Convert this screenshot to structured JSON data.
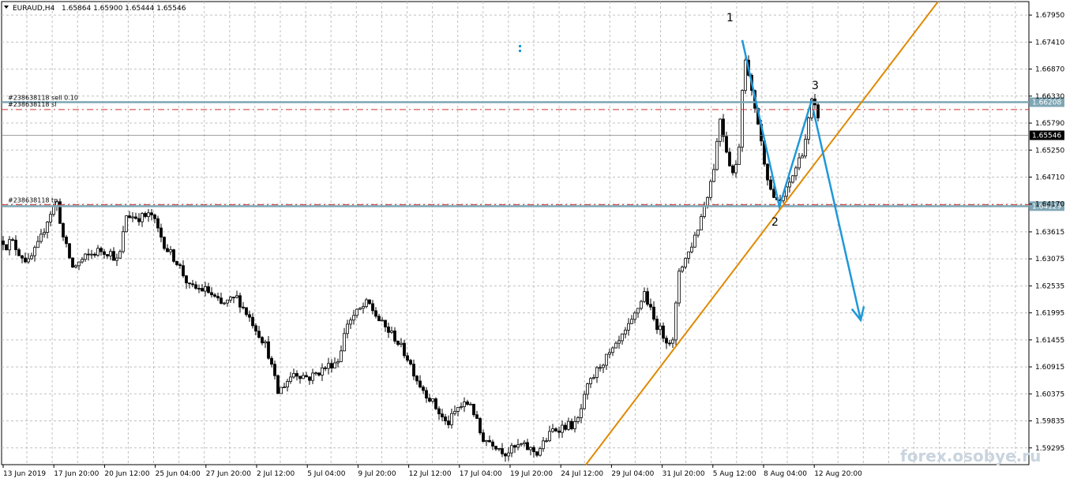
{
  "header": {
    "symbol_timeframe": "EURAUD,H4",
    "ohlc": "1.65864 1.65900 1.65444 1.65546"
  },
  "watermark": "forex.osobye.ru",
  "colors": {
    "grid": "#c0c0c0",
    "candle": "#000000",
    "trendline": "#e08a00",
    "arrows": "#1e98d8",
    "level": "#7fa6b4",
    "order": "#d03030",
    "bid": "#808080"
  },
  "chart_data": {
    "type": "candlestick",
    "ylim": [
      1.5896,
      1.6822
    ],
    "y_ticks": [
      "1.67950",
      "1.67410",
      "1.66870",
      "1.66330",
      "1.65790",
      "1.65250",
      "1.64710",
      "1.64170",
      "1.63615",
      "1.63075",
      "1.62535",
      "1.61995",
      "1.61455",
      "1.60915",
      "1.60375",
      "1.59835",
      "1.59295"
    ],
    "x_ticks": [
      "13 Jun 2019",
      "17 Jun 20:00",
      "20 Jun 12:00",
      "25 Jun 04:00",
      "27 Jun 20:00",
      "2 Jul 12:00",
      "5 Jul 04:00",
      "9 Jul 20:00",
      "12 Jul 12:00",
      "17 Jul 04:00",
      "19 Jul 20:00",
      "24 Jul 12:00",
      "29 Jul 04:00",
      "31 Jul 20:00",
      "5 Aug 12:00",
      "8 Aug 04:00",
      "12 Aug 20:00"
    ],
    "price_path": [
      [
        0,
        1.637
      ],
      [
        6,
        1.633
      ],
      [
        14,
        1.6345
      ],
      [
        24,
        1.632
      ],
      [
        36,
        1.63
      ],
      [
        50,
        1.634
      ],
      [
        62,
        1.6395
      ],
      [
        72,
        1.642
      ],
      [
        80,
        1.635
      ],
      [
        92,
        1.629
      ],
      [
        108,
        1.631
      ],
      [
        126,
        1.6325
      ],
      [
        140,
        1.632
      ],
      [
        150,
        1.63
      ],
      [
        160,
        1.6395
      ],
      [
        175,
        1.639
      ],
      [
        192,
        1.6395
      ],
      [
        210,
        1.633
      ],
      [
        225,
        1.63
      ],
      [
        240,
        1.625
      ],
      [
        262,
        1.6245
      ],
      [
        280,
        1.6215
      ],
      [
        300,
        1.623
      ],
      [
        320,
        1.618
      ],
      [
        338,
        1.613
      ],
      [
        352,
        1.604
      ],
      [
        372,
        1.608
      ],
      [
        392,
        1.607
      ],
      [
        412,
        1.609
      ],
      [
        428,
        1.6105
      ],
      [
        440,
        1.618
      ],
      [
        452,
        1.62
      ],
      [
        466,
        1.622
      ],
      [
        482,
        1.618
      ],
      [
        500,
        1.615
      ],
      [
        516,
        1.611
      ],
      [
        530,
        1.606
      ],
      [
        548,
        1.602
      ],
      [
        566,
        1.5975
      ],
      [
        580,
        1.601
      ],
      [
        596,
        1.602
      ],
      [
        610,
        1.595
      ],
      [
        624,
        1.594
      ],
      [
        640,
        1.592
      ],
      [
        660,
        1.5935
      ],
      [
        680,
        1.592
      ],
      [
        700,
        1.5965
      ],
      [
        718,
        1.5975
      ],
      [
        730,
        1.5975
      ],
      [
        744,
        1.605
      ],
      [
        760,
        1.6095
      ],
      [
        780,
        1.613
      ],
      [
        800,
        1.618
      ],
      [
        816,
        1.624
      ],
      [
        828,
        1.6185
      ],
      [
        842,
        1.615
      ],
      [
        852,
        1.614
      ],
      [
        860,
        1.6285
      ],
      [
        872,
        1.632
      ],
      [
        884,
        1.637
      ],
      [
        893,
        1.642
      ],
      [
        903,
        1.648
      ],
      [
        912,
        1.659
      ],
      [
        922,
        1.651
      ],
      [
        930,
        1.647
      ],
      [
        938,
        1.656
      ],
      [
        942,
        1.6735
      ],
      [
        950,
        1.665
      ],
      [
        958,
        1.66
      ],
      [
        966,
        1.652
      ],
      [
        975,
        1.645
      ],
      [
        985,
        1.6415
      ],
      [
        995,
        1.644
      ],
      [
        1008,
        1.649
      ],
      [
        1018,
        1.653
      ],
      [
        1028,
        1.662
      ],
      [
        1036,
        1.6595
      ]
    ],
    "levels": [
      {
        "label": "1.66208",
        "value": 1.66208
      },
      {
        "label": "1.64129",
        "value": 1.64129
      }
    ],
    "bid": {
      "label": "1.65546",
      "value": 1.65546
    },
    "orders": [
      {
        "label": "#238638118 sell 0.10",
        "value": 1.66208
      },
      {
        "label": "#238638118 sl",
        "value": 1.6606
      },
      {
        "label": "#238638118 tp",
        "value": 1.6416
      }
    ],
    "pattern_points": [
      {
        "label": "1",
        "bar": 940,
        "value": 1.6745
      },
      {
        "label": "2",
        "bar": 987,
        "value": 1.6412
      },
      {
        "label": "3",
        "bar": 1028,
        "value": 1.6625
      }
    ],
    "trendline": [
      [
        742,
        1.5896
      ],
      [
        1188,
        1.6822
      ]
    ],
    "forecast_arrow": [
      [
        1030,
        1.6605
      ],
      [
        1090,
        1.6185
      ]
    ]
  }
}
